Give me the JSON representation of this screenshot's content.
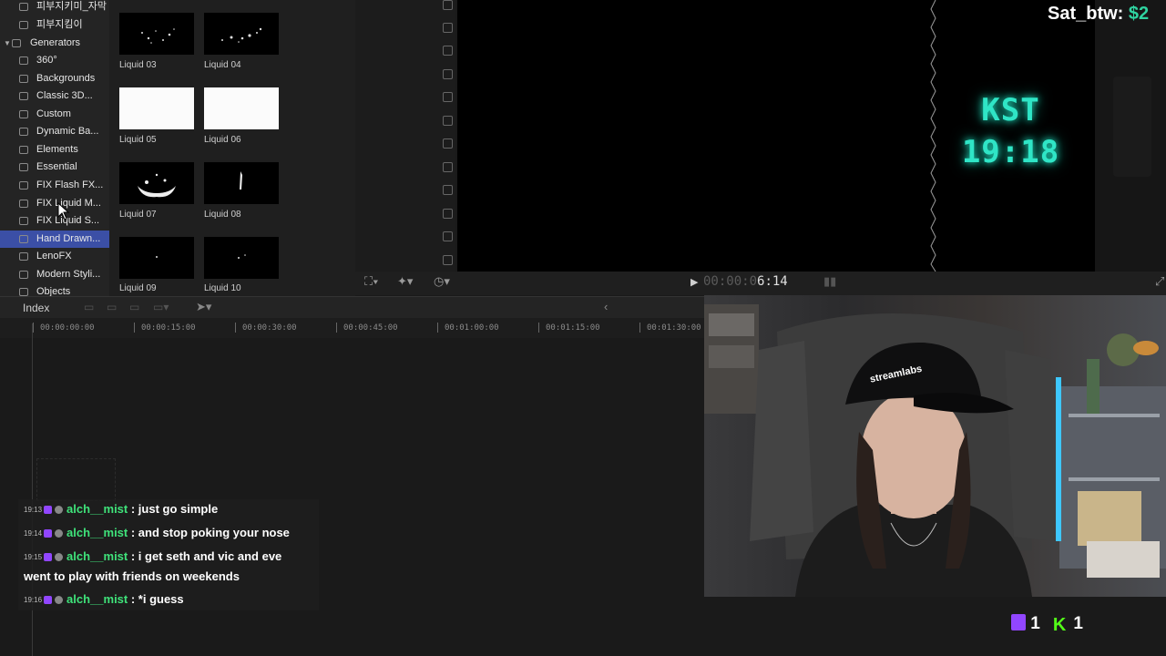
{
  "sidebar": {
    "items": [
      {
        "label": "피부지키미_자막"
      },
      {
        "label": "피부지킴이"
      },
      {
        "label": "Generators"
      },
      {
        "label": "360°"
      },
      {
        "label": "Backgrounds"
      },
      {
        "label": "Classic 3D..."
      },
      {
        "label": "Custom"
      },
      {
        "label": "Dynamic Ba..."
      },
      {
        "label": "Elements"
      },
      {
        "label": "Essential"
      },
      {
        "label": "FIX Flash FX..."
      },
      {
        "label": "FIX Liquid M..."
      },
      {
        "label": "FIX Liquid S..."
      },
      {
        "label": "Hand Drawn..."
      },
      {
        "label": "LenoFX"
      },
      {
        "label": "Modern Styli..."
      },
      {
        "label": "Objects"
      }
    ],
    "selected": "Hand Drawn..."
  },
  "browser": {
    "clips": [
      {
        "label": "Liquid 03"
      },
      {
        "label": "Liquid 04"
      },
      {
        "label": "Liquid 05"
      },
      {
        "label": "Liquid 06"
      },
      {
        "label": "Liquid 07"
      },
      {
        "label": "Liquid 08"
      },
      {
        "label": "Liquid 09"
      },
      {
        "label": "Liquid 10"
      }
    ]
  },
  "overlay": {
    "kst_label": "KST",
    "kst_time": "19:18",
    "sat_label": "Sat_btw:",
    "sat_value": "$2"
  },
  "viewer": {
    "timecode_dim": "00:00:0",
    "timecode_bright": "6:14"
  },
  "timeline": {
    "index_label": "Index",
    "ticks": [
      "00:00:00:00",
      "00:00:15:00",
      "00:00:30:00",
      "00:00:45:00",
      "00:01:00:00",
      "00:01:15:00",
      "00:01:30:00"
    ]
  },
  "chat": {
    "messages": [
      {
        "time": "19:13",
        "user": "alch__mist",
        "text": " : just go simple"
      },
      {
        "time": "19:14",
        "user": "alch__mist",
        "text": " : and stop poking your nose"
      },
      {
        "time": "19:15",
        "user": "alch__mist",
        "text": " : i get seth and vic and eve went to play with friends on weekends"
      },
      {
        "time": "19:16",
        "user": "alch__mist",
        "text": " : *i guess"
      }
    ]
  },
  "webcam": {
    "cap_text": "streamlabs"
  },
  "viewers": {
    "twitch_count": "1",
    "kick_count": "1",
    "kick_logo": "K"
  }
}
